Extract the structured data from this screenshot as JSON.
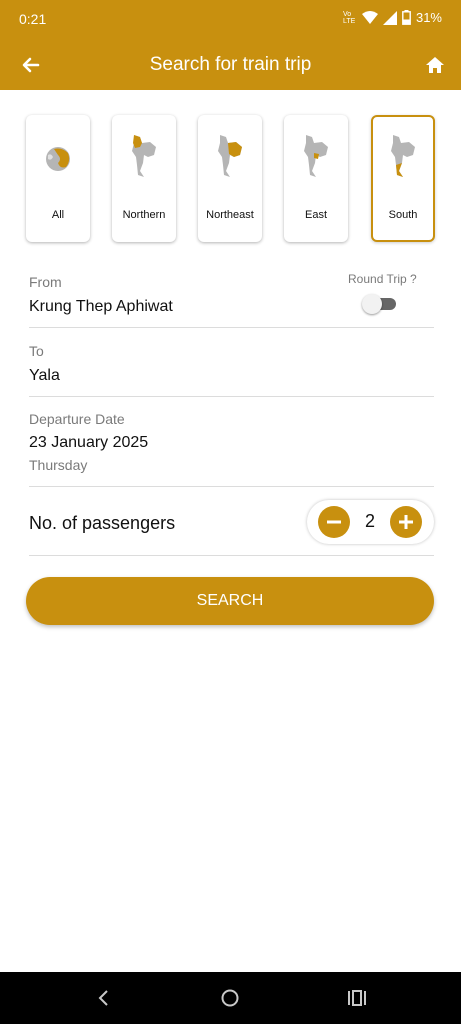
{
  "status_bar": {
    "time": "0:21",
    "network": "Vo LTE",
    "battery": "31%"
  },
  "app_bar": {
    "title": "Search for train trip"
  },
  "regions": [
    {
      "label": "All",
      "icon": "globe-icon"
    },
    {
      "label": "Northern",
      "icon": "thailand-north-map-icon"
    },
    {
      "label": "Northeast",
      "icon": "thailand-northeast-map-icon"
    },
    {
      "label": "East",
      "icon": "thailand-east-map-icon"
    },
    {
      "label": "South",
      "icon": "thailand-south-map-icon",
      "selected": true
    }
  ],
  "form": {
    "from_label": "From",
    "from_value": "Krung Thep Aphiwat",
    "round_trip_label": "Round Trip ?",
    "round_trip_on": false,
    "to_label": "To",
    "to_value": "Yala",
    "departure_label": "Departure Date",
    "departure_value": "23 January 2025",
    "departure_weekday": "Thursday",
    "passengers_label": "No. of passengers",
    "passengers_count": "2"
  },
  "search_button": "SEARCH",
  "colors": {
    "accent": "#C8900F",
    "map_gray": "#b5b5b5"
  }
}
